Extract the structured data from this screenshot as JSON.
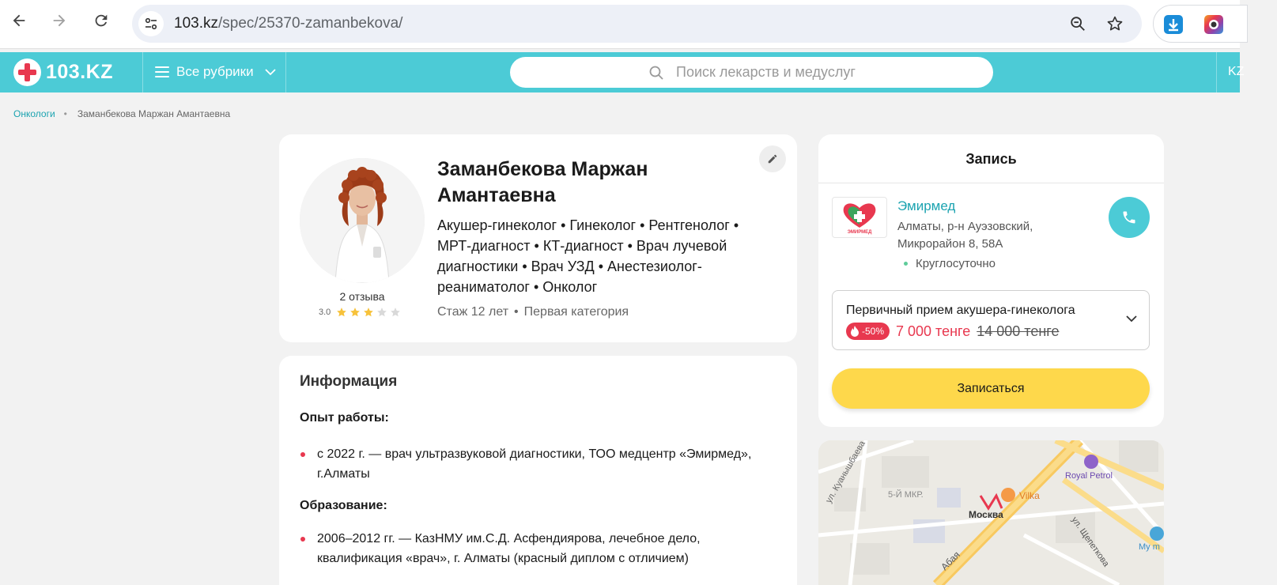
{
  "browser": {
    "url_host": "103.kz",
    "url_path": "/spec/25370-zamanbekova/"
  },
  "site": {
    "logo_text": "103.KZ",
    "rubrics_label": "Все рубрики",
    "search_placeholder": "Поиск лекарств и медуслуг",
    "lang_label": "KZ"
  },
  "breadcrumb": {
    "parent": "Онкологи",
    "current": "Заманбекова Маржан Амантаевна"
  },
  "doctor": {
    "name": "Заманбекова Маржан Амантаевна",
    "specialties": "Акушер-гинеколог • Гинеколог • Рентгенолог • МРТ-диагност • КТ-диагност • Врач лучевой диагностики • Врач УЗД • Анестезиолог-реаниматолог • Онколог",
    "experience": "Стаж 12 лет",
    "category": "Первая категория",
    "reviews_label": "2 отзыва",
    "rating_text": "3.0",
    "rating_value": 3,
    "rating_max": 5
  },
  "info": {
    "title": "Информация",
    "work_heading": "Опыт работы:",
    "work_items": [
      "с 2022 г. — врач ультразвуковой диагностики, ТОО медцентр «Эмирмед», г.Алматы"
    ],
    "edu_heading": "Образование:",
    "edu_items": [
      "2006–2012 гг. — КазНМУ им.С.Д. Асфендиярова, лечебное дело, квалификация «врач», г. Алматы (красный диплом с отличием)"
    ]
  },
  "booking": {
    "title": "Запись",
    "clinic_name": "Эмирмед",
    "clinic_logo_text": "ЭМИРМЕД",
    "clinic_address": "Алматы, р-н Ауэзовский, Микрорайон 8, 58А",
    "clinic_hours": "Круглосуточно",
    "service_name": "Первичный прием акушера-гинеколога",
    "discount": "-50%",
    "price_new": "7 000 тенге",
    "price_old": "14 000 тенге",
    "book_label": "Записаться"
  },
  "map": {
    "labels": {
      "street1": "ул. Куанышбаева",
      "district": "5-Й МКР.",
      "metro": "Москва",
      "vilka": "Vilka",
      "royal": "Royal Petrol",
      "abaya": "Абая",
      "shchepetkova": "ул. Щепеткова",
      "mymart": "My m"
    }
  },
  "colors": {
    "header_bg": "#4ccbd6",
    "accent_red": "#e8384f",
    "link": "#1ba3b0",
    "book_button": "#fed84b",
    "star_on": "#f7c23b",
    "star_off": "#d9d9d9"
  }
}
